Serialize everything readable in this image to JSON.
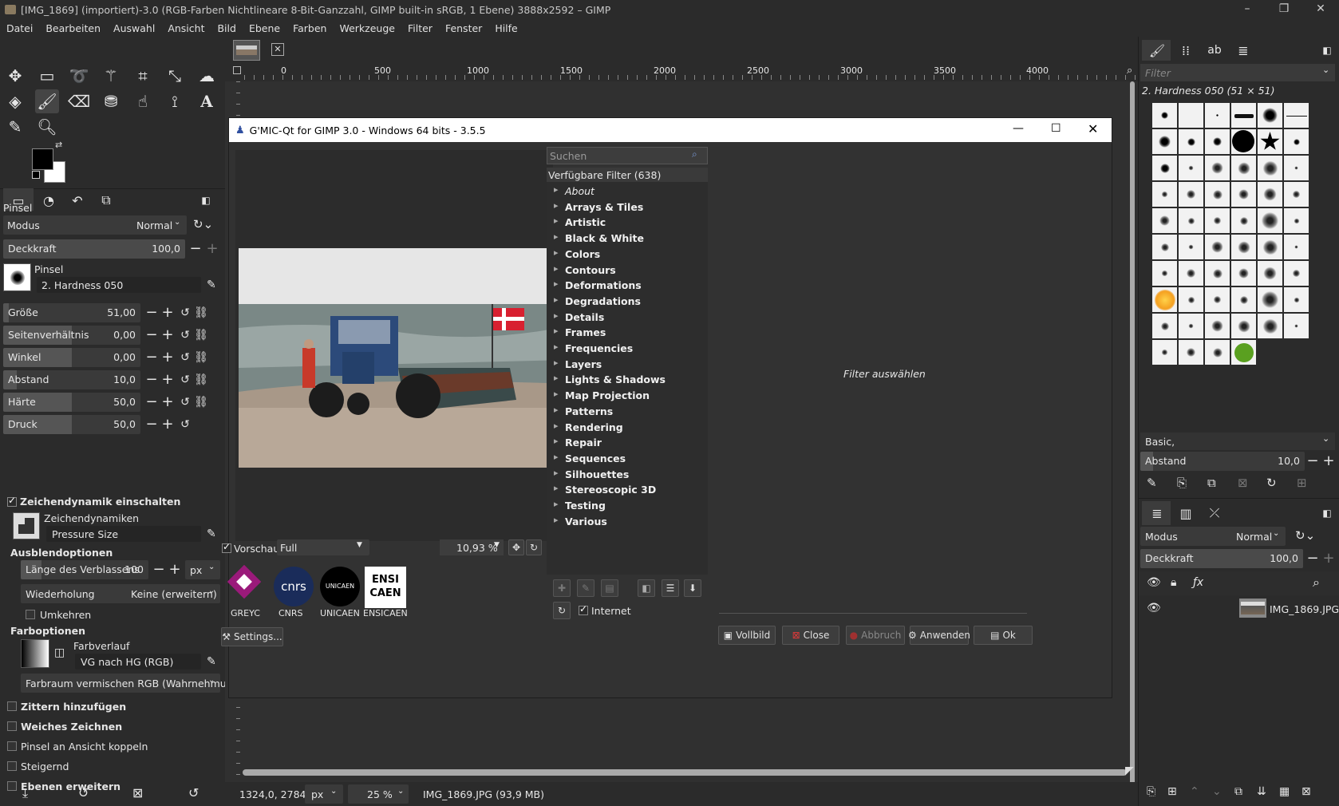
{
  "window": {
    "title": "[IMG_1869] (importiert)-3.0 (RGB-Farben Nichtlineare 8-Bit-Ganzzahl, GIMP built-in sRGB, 1 Ebene) 3888x2592 – GIMP",
    "min": "–",
    "max": "❐",
    "close": "✕"
  },
  "menubar": [
    "Datei",
    "Bearbeiten",
    "Auswahl",
    "Ansicht",
    "Bild",
    "Ebene",
    "Farben",
    "Werkzeuge",
    "Filter",
    "Fenster",
    "Hilfe"
  ],
  "tool_options": {
    "title": "Pinsel",
    "mode_label": "Modus",
    "mode_value": "Normal",
    "opacity_label": "Deckkraft",
    "opacity_value": "100,0",
    "brush_label": "Pinsel",
    "brush_value": "2. Hardness 050",
    "sliders": [
      {
        "label": "Größe",
        "value": "51,00",
        "level": 0.04
      },
      {
        "label": "Seitenverhältnis",
        "value": "0,00",
        "level": 0.5
      },
      {
        "label": "Winkel",
        "value": "0,00",
        "level": 0.5
      },
      {
        "label": "Abstand",
        "value": "10,0",
        "level": 0.1
      },
      {
        "label": "Härte",
        "value": "50,0",
        "level": 0.5
      },
      {
        "label": "Druck",
        "value": "50,0",
        "level": 0.5
      }
    ],
    "dynamics_enable": "Zeichendynamik einschalten",
    "dynamics_label": "Zeichendynamiken",
    "dynamics_value": "Pressure Size",
    "fade_options": "Ausblendoptionen",
    "fade_length_label": "Länge des Verblassens",
    "fade_length_value": "100",
    "fade_unit": "px",
    "repeat_label": "Wiederholung",
    "repeat_value": "Keine (erweitern)",
    "reverse": "Umkehren",
    "color_options": "Farboptionen",
    "gradient_label": "Farbverlauf",
    "gradient_value": "VG nach HG (RGB)",
    "blend_value": "Farbraum vermischen RGB (Wahrnehmu...",
    "jitter": "Zittern hinzufügen",
    "smooth": "Weiches Zeichnen",
    "lock_view": "Pinsel an Ansicht koppeln",
    "incremental": "Steigernd",
    "expand_layers": "Ebenen erweitern"
  },
  "ruler_ticks": [
    "0",
    "500",
    "1000",
    "1500",
    "2000",
    "2500",
    "3000",
    "3500",
    "4000"
  ],
  "gmic": {
    "title": "G'MIC-Qt for GIMP 3.0 - Windows 64 bits - 3.5.5",
    "search_placeholder": "Suchen",
    "filters_header": "Verfügbare Filter (638)",
    "categories": [
      "About",
      "Arrays & Tiles",
      "Artistic",
      "Black & White",
      "Colors",
      "Contours",
      "Deformations",
      "Degradations",
      "Details",
      "Frames",
      "Frequencies",
      "Layers",
      "Lights & Shadows",
      "Map Projection",
      "Patterns",
      "Rendering",
      "Repair",
      "Sequences",
      "Silhouettes",
      "Stereoscopic 3D",
      "Testing",
      "Various"
    ],
    "select_filter": "Filter auswählen",
    "preview_label": "Vorschau",
    "preview_mode": "Full",
    "zoom": "10,93 %",
    "internet": "Internet",
    "logos": [
      "GREYC",
      "CNRS",
      "UNICAEN",
      "ENSICAEN"
    ],
    "settings": "Settings...",
    "buttons": {
      "fullscreen": "Vollbild",
      "close": "Close",
      "cancel": "Abbruch",
      "apply": "Anwenden",
      "ok": "Ok"
    }
  },
  "status": {
    "coords": "1324,0, 2784,0",
    "unit": "px",
    "zoom": "25 %",
    "file": "IMG_1869.JPG (93,9 MB)"
  },
  "brushes_panel": {
    "filter_placeholder": "Filter",
    "brush_name": "2. Hardness 050 (51 × 51)",
    "preset": "Basic,",
    "spacing_label": "Abstand",
    "spacing_value": "10,0"
  },
  "layers_panel": {
    "mode_label": "Modus",
    "mode_value": "Normal",
    "opacity_label": "Deckkraft",
    "opacity_value": "100,0",
    "layer_name": "IMG_1869.JPG"
  }
}
